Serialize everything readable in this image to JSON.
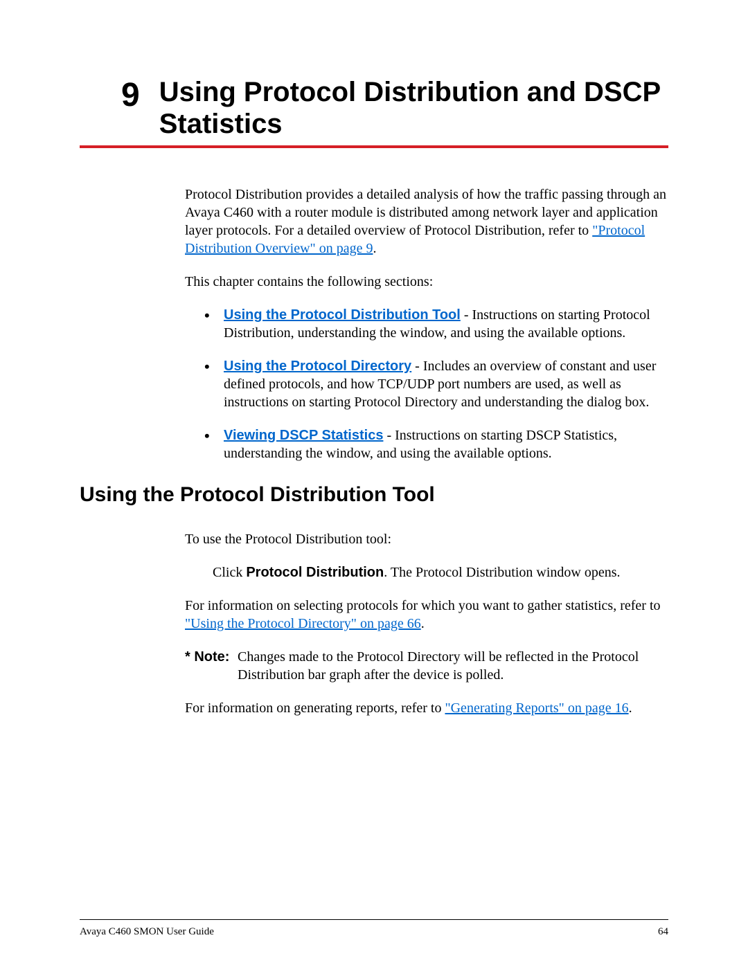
{
  "chapter": {
    "number": "9",
    "title": "Using Protocol Distribution and DSCP Statistics"
  },
  "intro": {
    "text_before": "Protocol Distribution provides a detailed analysis of how the traffic passing through an Avaya C460 with a router module is distributed among network layer and application layer protocols. For a detailed overview of Protocol Distribution, refer to ",
    "link": "\"Protocol Distribution Overview\" on page 9",
    "text_after": "."
  },
  "sections_intro": "This chapter contains the following sections:",
  "bullets": [
    {
      "link": "Using the Protocol Distribution Tool",
      "desc": " - Instructions on starting Protocol Distribution, understanding the window, and using the available options."
    },
    {
      "link": "Using the Protocol Directory",
      "desc": " - Includes an overview of constant and user defined protocols, and how TCP/UDP port numbers are used, as well as instructions on starting Protocol Directory and understanding the dialog box."
    },
    {
      "link": "Viewing DSCP Statistics",
      "desc": " - Instructions on starting DSCP Statistics, understanding the window, and using the available options."
    }
  ],
  "section_heading": "Using the Protocol Distribution Tool",
  "section_body": {
    "lead": "To use the Protocol Distribution tool:",
    "step_before": "Click ",
    "step_bold": "Protocol Distribution",
    "step_after": ". The Protocol Distribution window opens.",
    "p2_before": "For information on selecting protocols for which you want to gather statistics, refer to ",
    "p2_link": "\"Using the Protocol Directory\" on page 66",
    "p2_after": ".",
    "note_label": "* Note:",
    "note_text": "Changes made to the Protocol Directory will be reflected in the Protocol Distribution bar graph after the device is polled.",
    "p3_before": "For information on generating reports, refer to ",
    "p3_link": "\"Generating Reports\" on page 16",
    "p3_after": "."
  },
  "footer": {
    "left": "Avaya C460 SMON User Guide",
    "right": "64"
  }
}
